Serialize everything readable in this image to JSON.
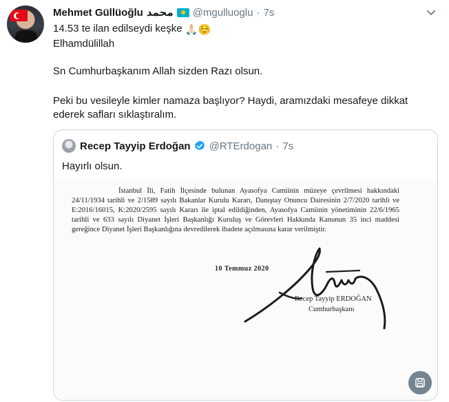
{
  "author": {
    "name": "Mehmet Güllüoğlu",
    "name_arabic": "محمد",
    "handle": "@mgulluoglu",
    "separator": "·",
    "time": "7s"
  },
  "tweet": {
    "line1": "14.53 te ilan edilseydi keşke",
    "line1_emoji": "🙏🏻☺️",
    "line2": "Elhamdülillah",
    "para2": "Sn Cumhurbaşkanım Allah sizden Razı olsun.",
    "para3": "Peki bu vesileyle kimler namaza başlıyor? Haydi, aramızdaki mesafeye dikkat ederek safları sıklaştıralım."
  },
  "quote": {
    "name": "Recep Tayyip Erdoğan",
    "handle": "@RTErdogan",
    "separator": "·",
    "time": "7s",
    "text": "Hayırlı olsun.",
    "document": {
      "body": "İstanbul İli, Fatih İlçesinde bulunan Ayasofya Camiinin müzeye çevrilmesi hakkındaki 24/11/1934 tarihli ve 2/1589 sayılı Bakanlar Kurulu Kararı, Danıştay Onuncu Dairesinin 2/7/2020 tarihli ve E:2016/16015, K:2020/2595 sayılı Kararı ile iptal edildiğinden, Ayasofya Camiinin yönetiminin 22/6/1965 tarihli ve 633 sayılı Diyanet İşleri Başkanlığı Kuruluş ve Görevleri Hakkında Kanunun 35 inci maddesi gereğince Diyanet İşleri Başkanlığına devredilerek ibadete açılmasına karar verilmiştir.",
      "date": "10 Temmuz 2020",
      "signer_name": "Recep Tayyip ERDOĞAN",
      "signer_title": "Cumhurbaşkanı"
    }
  },
  "icons": {
    "caret": "chevron-down-icon",
    "verified": "verified-badge-icon",
    "save": "save-image-icon"
  },
  "colors": {
    "text": "#14171a",
    "secondary": "#657786",
    "verified": "#1da1f2",
    "border": "#ccd6dd"
  }
}
